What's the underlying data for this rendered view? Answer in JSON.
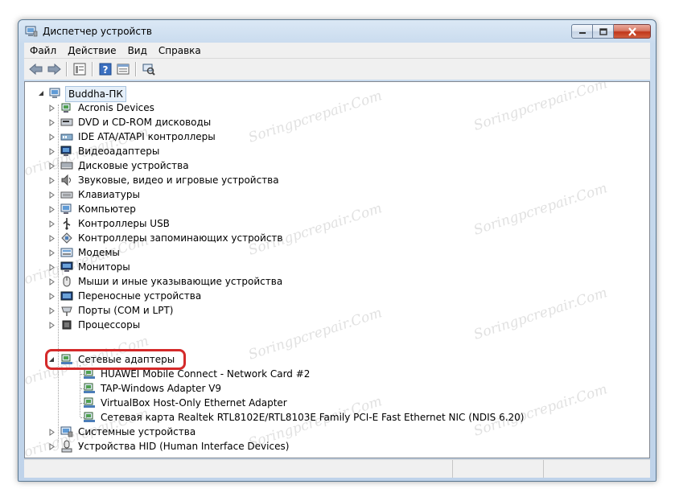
{
  "window": {
    "title": "Диспетчер устройств"
  },
  "menu": [
    {
      "label": "Файл"
    },
    {
      "label": "Действие"
    },
    {
      "label": "Вид"
    },
    {
      "label": "Справка"
    }
  ],
  "toolbar": {
    "icons": [
      "back-icon",
      "forward-icon",
      "properties-icon",
      "help-icon",
      "view-icon",
      "scan-hardware-icon"
    ]
  },
  "tree": {
    "root": "Buddha-ПК",
    "categories": [
      {
        "label": "Acronis Devices",
        "icon": "acronis-icon"
      },
      {
        "label": "DVD и CD-ROM дисководы",
        "icon": "dvd-icon"
      },
      {
        "label": "IDE ATA/ATAPI контроллеры",
        "icon": "ide-icon"
      },
      {
        "label": "Видеоадаптеры",
        "icon": "display-adapter-icon"
      },
      {
        "label": "Дисковые устройства",
        "icon": "disk-icon"
      },
      {
        "label": "Звуковые, видео и игровые устройства",
        "icon": "sound-icon"
      },
      {
        "label": "Клавиатуры",
        "icon": "keyboard-icon"
      },
      {
        "label": "Компьютер",
        "icon": "computer-icon"
      },
      {
        "label": "Контроллеры USB",
        "icon": "usb-icon"
      },
      {
        "label": "Контроллеры запоминающих устройств",
        "icon": "storage-controller-icon"
      },
      {
        "label": "Модемы",
        "icon": "modem-icon"
      },
      {
        "label": "Мониторы",
        "icon": "monitor-icon"
      },
      {
        "label": "Мыши и иные указывающие устройства",
        "icon": "mouse-icon"
      },
      {
        "label": "Переносные устройства",
        "icon": "portable-device-icon"
      },
      {
        "label": "Порты (COM и LPT)",
        "icon": "port-icon"
      },
      {
        "label": "Процессоры",
        "icon": "processor-icon"
      }
    ],
    "network": {
      "label": "Сетевые адаптеры",
      "children": [
        "HUAWEI Mobile Connect - Network Card #2",
        "TAP-Windows Adapter V9",
        "VirtualBox Host-Only Ethernet Adapter",
        "Сетевая карта Realtek RTL8102E/RTL8103E Family PCI-E Fast Ethernet NIC (NDIS 6.20)"
      ]
    },
    "after": [
      {
        "label": "Системные устройства",
        "icon": "system-device-icon"
      },
      {
        "label": "Устройства HID (Human Interface Devices)",
        "icon": "hid-icon"
      }
    ]
  },
  "watermark": "Soringpcrepair.Com",
  "colors": {
    "highlight": "#d42a2a",
    "title_gradient_top": "#dbe8f5"
  }
}
